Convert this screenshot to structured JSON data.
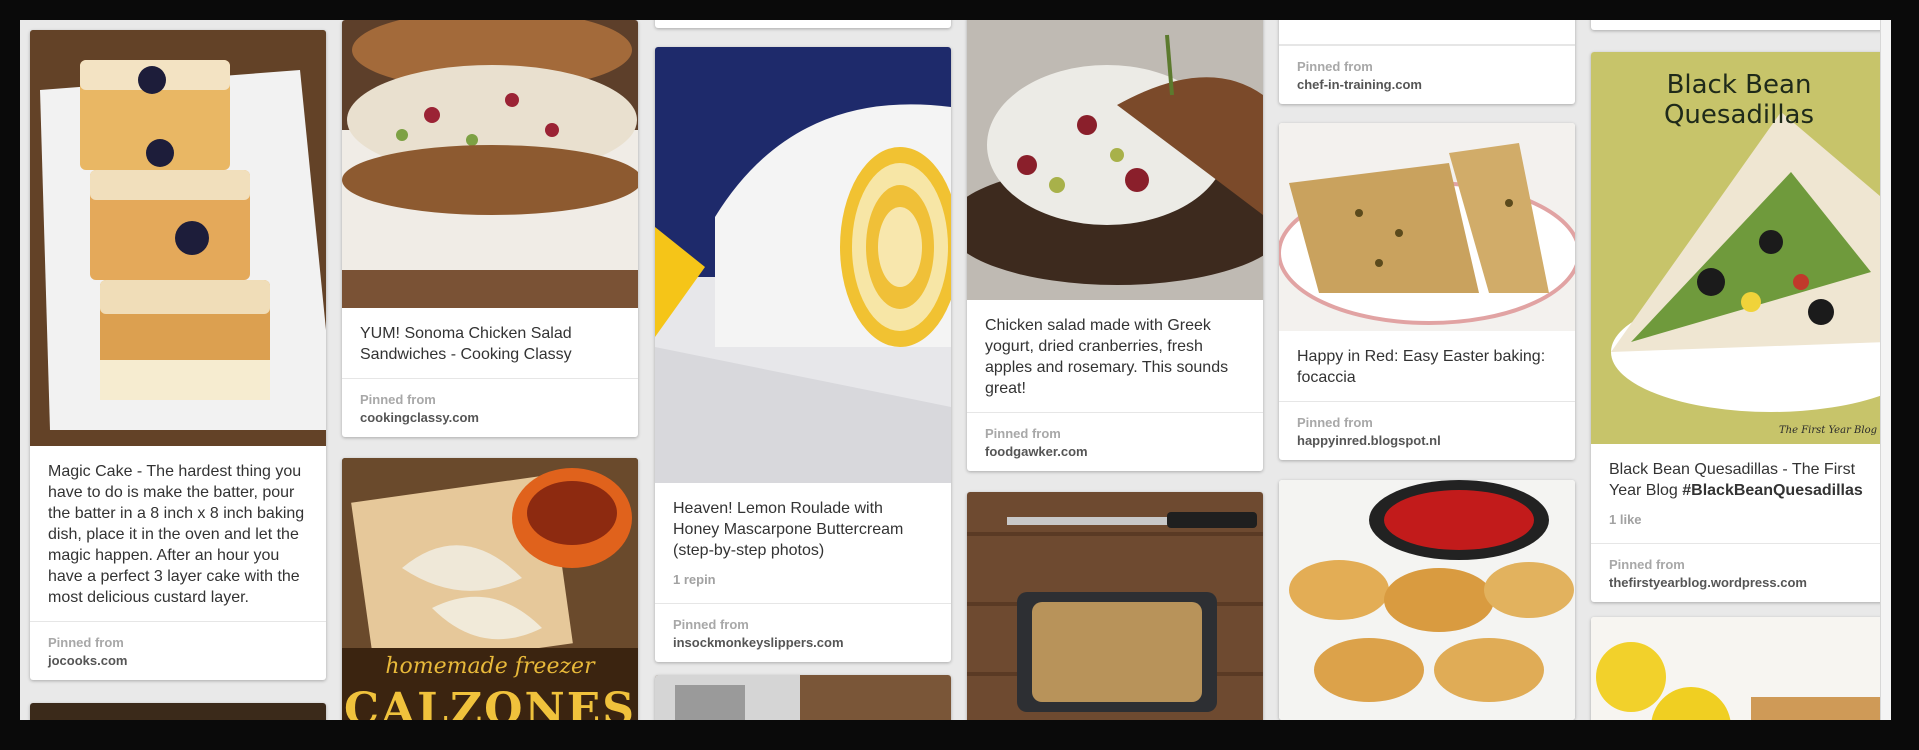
{
  "pins": {
    "magic_cake": {
      "description": "Magic Cake - The hardest thing you have to do is make the batter, pour the batter in a 8 inch x 8 inch baking dish, place it in the oven and let the magic happen. After an hour you have a perfect 3 layer cake with the most delicious custard layer.",
      "source_label": "Pinned from",
      "source": "jocooks.com"
    },
    "sonoma_chicken": {
      "description": "YUM! Sonoma Chicken Salad Sandwiches - Cooking Classy",
      "source_label": "Pinned from",
      "source": "cookingclassy.com"
    },
    "calzones": {
      "overlay_line1": "homemade freezer",
      "overlay_line2": "CALZONES"
    },
    "lemon_roulade": {
      "description": "Heaven! Lemon Roulade with Honey Mascarpone Buttercream (step-by-step photos)",
      "meta": "1 repin",
      "source_label": "Pinned from",
      "source": "insockmonkeyslippers.com"
    },
    "greek_chicken": {
      "description": "Chicken salad made with Greek yogurt, dried cranberries, fresh apples and rosemary. This sounds great!",
      "source_label": "Pinned from",
      "source": "foodgawker.com"
    },
    "chef_stub": {
      "source_label": "Pinned from",
      "source": "chef-in-training.com"
    },
    "focaccia": {
      "description": "Happy in Red: Easy Easter baking: focaccia",
      "source_label": "Pinned from",
      "source": "happyinred.blogspot.nl"
    },
    "quesadillas": {
      "image_title": "Black Bean Quesadillas",
      "image_watermark": "The First Year Blog",
      "description_plain": "Black Bean Quesadillas - The First Year Blog ",
      "description_tag": "#BlackBeanQuesadillas",
      "meta": "1 like",
      "source_label": "Pinned from",
      "source": "thefirstyearblog.wordpress.com"
    }
  },
  "colors": {
    "card_bg": "#ffffff",
    "board_bg": "#e9e9e9",
    "text": "#333333",
    "muted": "#a2a2a2"
  }
}
